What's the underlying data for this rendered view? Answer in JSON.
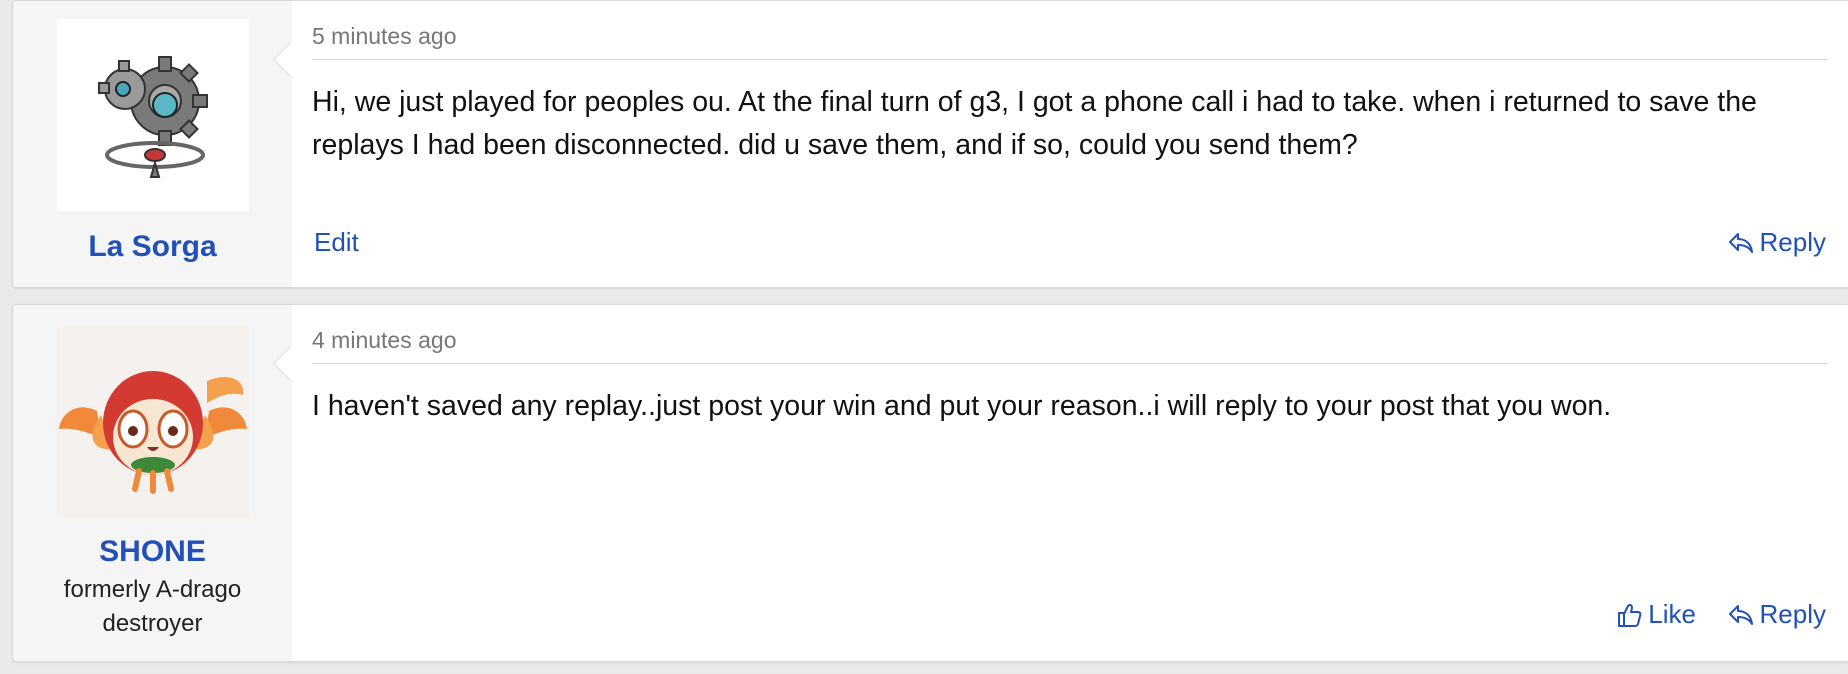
{
  "posts": [
    {
      "username": "La Sorga",
      "user_title": "",
      "avatar_icon": "gear-pokemon-avatar-icon",
      "timestamp": "5 minutes ago",
      "body": "Hi, we just played for peoples ou. At the final turn of g3, I got a phone call i had to take. when i returned to save the replays I had been disconnected. did u save them, and if so, could you send them?",
      "actions": {
        "edit": "Edit",
        "reply": "Reply"
      }
    },
    {
      "username": "SHONE",
      "user_title": "formerly A-drago destroyer",
      "avatar_icon": "owl-pokemon-avatar-icon",
      "timestamp": "4 minutes ago",
      "body": "I haven't saved any replay..just post your win and put your reason..i will reply to your post that you won.",
      "actions": {
        "like": "Like",
        "reply": "Reply"
      }
    }
  ],
  "colors": {
    "link": "#2150b8",
    "user_column_bg": "#f5f5f5",
    "page_bg": "#eaeaea"
  }
}
